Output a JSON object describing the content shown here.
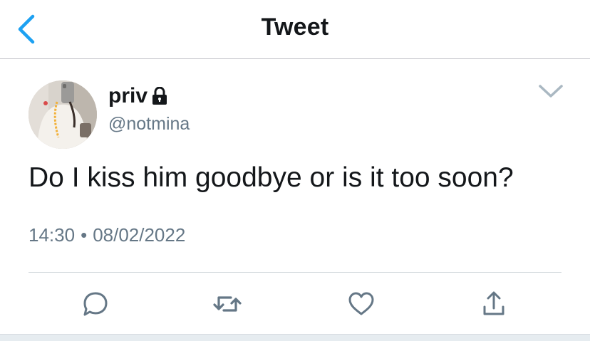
{
  "header": {
    "title": "Tweet",
    "back_icon": "chevron-left-icon"
  },
  "tweet": {
    "display_name": "priv",
    "handle": "@notmina",
    "protected_icon": "lock-icon",
    "menu_icon": "chevron-down-icon",
    "text": "Do I kiss him goodbye or is it too soon?",
    "time": "14:30",
    "separator": "•",
    "date": "08/02/2022"
  },
  "actions": [
    {
      "name": "reply",
      "icon": "reply-icon"
    },
    {
      "name": "retweet",
      "icon": "retweet-icon"
    },
    {
      "name": "like",
      "icon": "heart-icon"
    },
    {
      "name": "share",
      "icon": "share-icon"
    }
  ],
  "colors": {
    "accent": "#1da1f2",
    "text_primary": "#14171a",
    "text_secondary": "#657786",
    "icon": "#657786"
  }
}
